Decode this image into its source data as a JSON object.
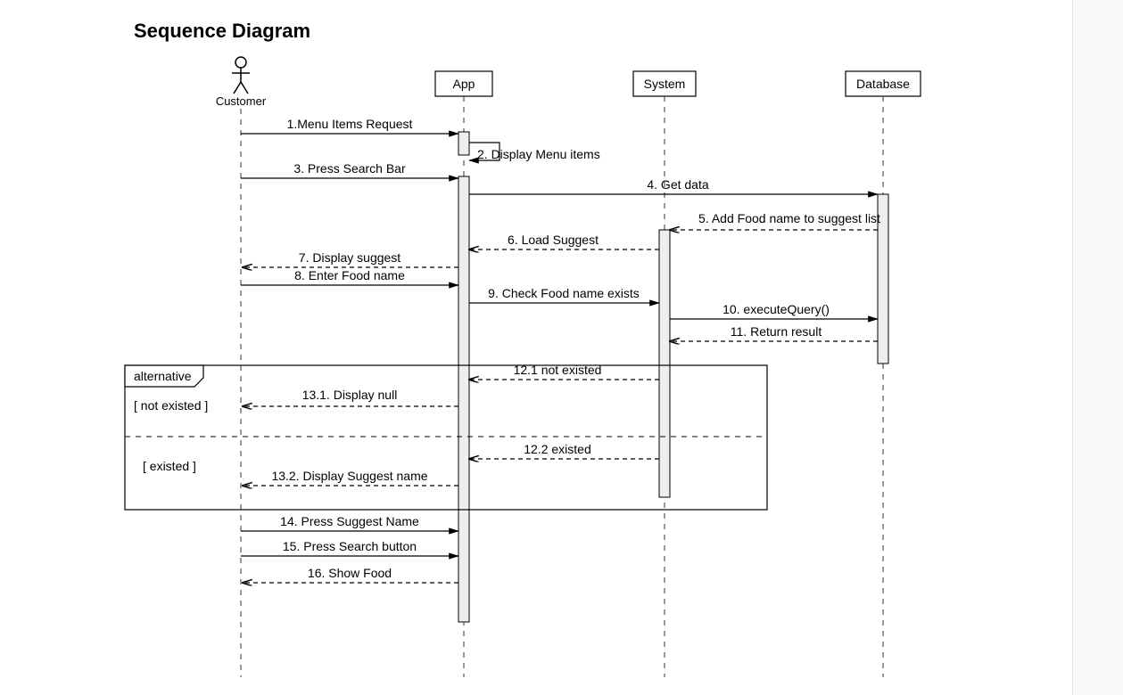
{
  "title": "Sequence Diagram",
  "participants": {
    "customer": "Customer",
    "app": "App",
    "system": "System",
    "database": "Database"
  },
  "messages": {
    "m1": "1.Menu Items Request",
    "m2": "2. Display Menu items",
    "m3": "3. Press Search Bar",
    "m4": "4. Get data",
    "m5": "5. Add Food name to suggest list",
    "m6": "6. Load Suggest",
    "m7": "7. Display suggest",
    "m8": "8. Enter Food name",
    "m9": "9. Check Food name exists",
    "m10": "10. executeQuery()",
    "m11": "11. Return result",
    "m12_1": "12.1 not existed",
    "m13_1": "13.1. Display null",
    "m12_2": "12.2 existed",
    "m13_2": "13.2. Display Suggest name",
    "m14": "14. Press Suggest Name",
    "m15": "15. Press Search button",
    "m16": "16. Show Food"
  },
  "fragment": {
    "label": "alternative",
    "guard1": "[ not existed ]",
    "guard2": "[ existed ]"
  }
}
